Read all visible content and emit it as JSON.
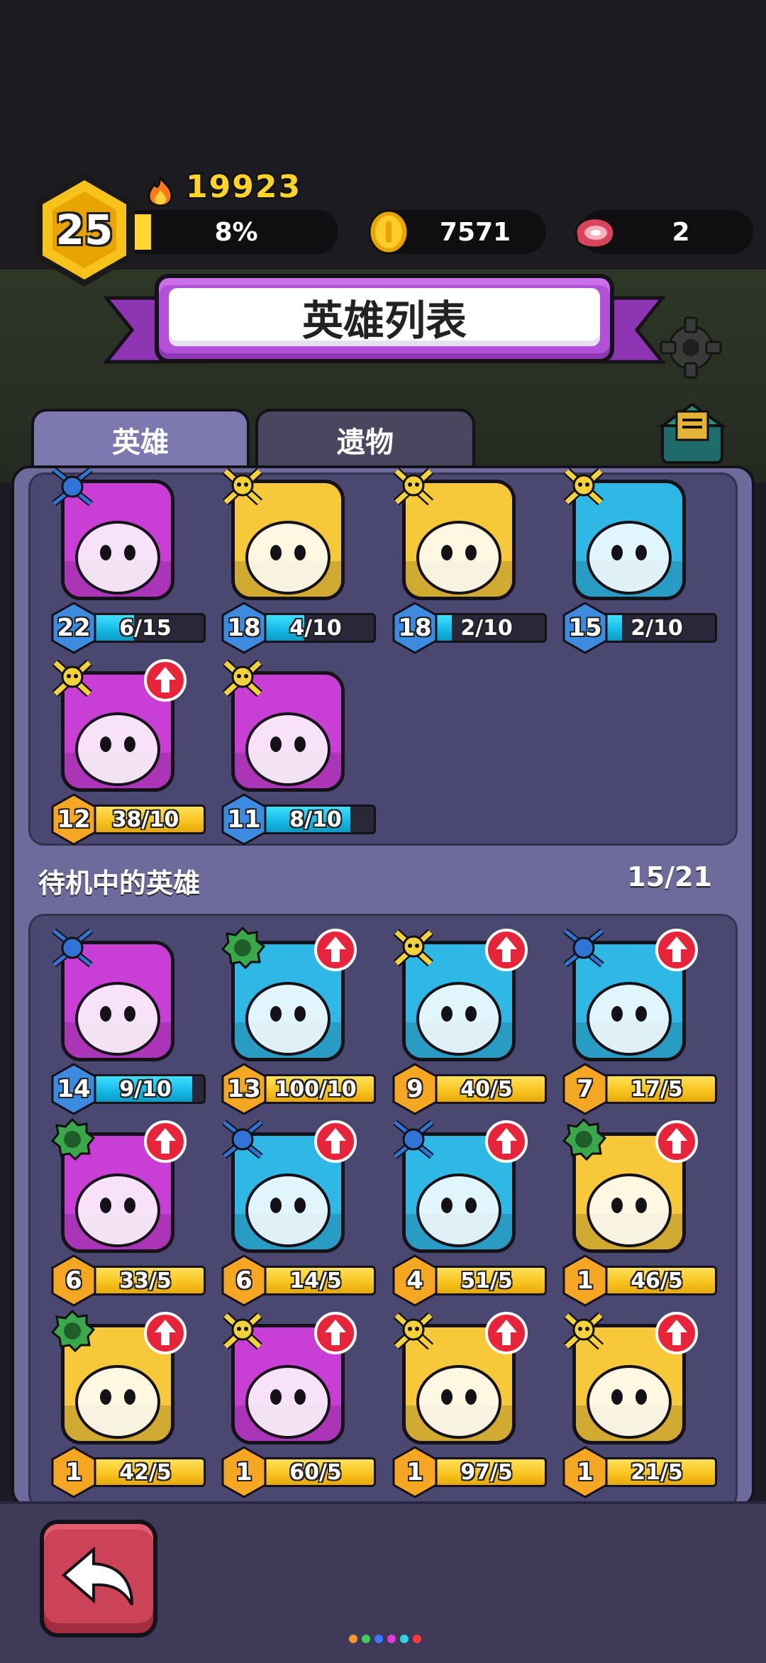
{
  "player": {
    "level": "25",
    "power": "19923",
    "xp_percent_label": "8%",
    "xp_fraction": 0.08,
    "gold": "7571",
    "meat": "2"
  },
  "title": "英雄列表",
  "tabs": [
    {
      "label": "英雄",
      "active": true
    },
    {
      "label": "遗物",
      "active": false
    }
  ],
  "active_heroes": [
    {
      "level": "22",
      "shards": "6/15",
      "fill": 0.4,
      "bar": "cyan",
      "badge": "blue",
      "upgrade": false,
      "bg": "#c93fd6",
      "icon": "mummy-hero-icon",
      "levelColor": "#3d8be0"
    },
    {
      "level": "18",
      "shards": "4/10",
      "fill": 0.4,
      "bar": "cyan",
      "badge": "gold",
      "upgrade": false,
      "bg": "#f6c83a",
      "icon": "dark-knight-hero-icon",
      "levelColor": "#3d8be0"
    },
    {
      "level": "18",
      "shards": "2/10",
      "fill": 0.2,
      "bar": "cyan",
      "badge": "gold",
      "upgrade": false,
      "bg": "#f6c83a",
      "icon": "pope-hero-icon",
      "levelColor": "#3d8be0"
    },
    {
      "level": "15",
      "shards": "2/10",
      "fill": 0.2,
      "bar": "cyan",
      "badge": "gold",
      "upgrade": false,
      "bg": "#2fb8e6",
      "icon": "samurai-hero-icon",
      "levelColor": "#3d8be0"
    },
    {
      "level": "12",
      "shards": "38/10",
      "fill": 1,
      "bar": "gold",
      "badge": "gold",
      "upgrade": true,
      "bg": "#c93fd6",
      "icon": "pirate-hero-icon",
      "levelColor": "#f5a623"
    },
    {
      "level": "11",
      "shards": "8/10",
      "fill": 0.8,
      "bar": "cyan",
      "badge": "gold",
      "upgrade": false,
      "bg": "#c93fd6",
      "icon": "armored-knight-hero-icon",
      "levelColor": "#3d8be0"
    }
  ],
  "standby_section": {
    "title": "待机中的英雄",
    "count": "15/21"
  },
  "standby_heroes": [
    {
      "level": "14",
      "shards": "9/10",
      "fill": 0.9,
      "bar": "cyan",
      "badge": "blue",
      "upgrade": false,
      "bg": "#c93fd6",
      "icon": "shark-hero-icon",
      "levelColor": "#3d8be0"
    },
    {
      "level": "13",
      "shards": "100/10",
      "fill": 1,
      "bar": "gold",
      "badge": "green",
      "upgrade": true,
      "bg": "#2fb8e6",
      "icon": "robot-hero-icon",
      "levelColor": "#f5a623"
    },
    {
      "level": "9",
      "shards": "40/5",
      "fill": 1,
      "bar": "gold",
      "badge": "gold",
      "upgrade": true,
      "bg": "#2fb8e6",
      "icon": "cat-hero-icon",
      "levelColor": "#f5a623"
    },
    {
      "level": "7",
      "shards": "17/5",
      "fill": 1,
      "bar": "gold",
      "badge": "blue",
      "upgrade": true,
      "bg": "#2fb8e6",
      "icon": "cloud-hero-icon",
      "levelColor": "#f5a623"
    },
    {
      "level": "6",
      "shards": "33/5",
      "fill": 1,
      "bar": "gold",
      "badge": "green",
      "upgrade": true,
      "bg": "#c93fd6",
      "icon": "leaf-hero-icon",
      "levelColor": "#f5a623"
    },
    {
      "level": "6",
      "shards": "14/5",
      "fill": 1,
      "bar": "gold",
      "badge": "blue",
      "upgrade": true,
      "bg": "#2fb8e6",
      "icon": "spiked-helmet-hero-icon",
      "levelColor": "#f5a623"
    },
    {
      "level": "4",
      "shards": "51/5",
      "fill": 1,
      "bar": "gold",
      "badge": "blue",
      "upgrade": true,
      "bg": "#2fb8e6",
      "icon": "snowman-hero-icon",
      "levelColor": "#f5a623"
    },
    {
      "level": "1",
      "shards": "46/5",
      "fill": 1,
      "bar": "gold",
      "badge": "green",
      "upgrade": true,
      "bg": "#f6c83a",
      "icon": "wolf-hero-icon",
      "levelColor": "#f5a623"
    },
    {
      "level": "1",
      "shards": "42/5",
      "fill": 1,
      "bar": "gold",
      "badge": "green",
      "upgrade": true,
      "bg": "#f6c83a",
      "icon": "armored-beast-hero-icon",
      "levelColor": "#f5a623"
    },
    {
      "level": "1",
      "shards": "60/5",
      "fill": 1,
      "bar": "gold",
      "badge": "gold",
      "upgrade": true,
      "bg": "#c93fd6",
      "icon": "robin-hood-hero-icon",
      "levelColor": "#f5a623"
    },
    {
      "level": "1",
      "shards": "97/5",
      "fill": 1,
      "bar": "gold",
      "badge": "gold",
      "upgrade": true,
      "bg": "#f6c83a",
      "icon": "helmet-hero-icon",
      "levelColor": "#f5a623"
    },
    {
      "level": "1",
      "shards": "21/5",
      "fill": 1,
      "bar": "gold",
      "badge": "gold",
      "upgrade": true,
      "bg": "#f6c83a",
      "icon": "slime-hero-icon",
      "levelColor": "#f5a623"
    }
  ],
  "colors": {
    "blue_badge": "#2f74d6",
    "gold_badge": "#f6d23a",
    "green_badge": "#3aa84a",
    "upgrade_red": "#e8243a"
  }
}
